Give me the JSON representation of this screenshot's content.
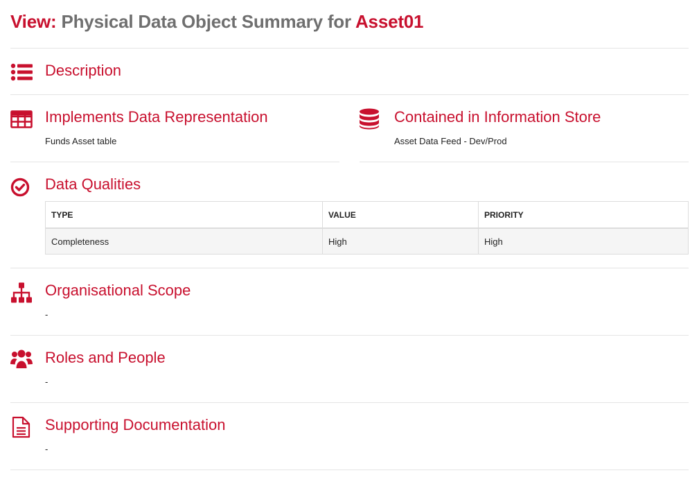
{
  "header": {
    "prefix": "View:",
    "title": "Physical Data Object Summary for",
    "entity": "Asset01"
  },
  "colors": {
    "accent": "#c8102e",
    "muted": "#6f6f6f",
    "divider": "#e4e4e4"
  },
  "sections": {
    "description": {
      "title": "Description",
      "icon": "list-icon"
    },
    "implements": {
      "title": "Implements Data Representation",
      "value": "Funds Asset table",
      "icon": "table-icon"
    },
    "contained": {
      "title": "Contained in Information Store",
      "value": "Asset Data Feed - Dev/Prod",
      "icon": "database-icon"
    },
    "qualities": {
      "title": "Data Qualities",
      "icon": "check-circle-icon",
      "columns": [
        "TYPE",
        "VALUE",
        "PRIORITY"
      ],
      "rows": [
        [
          "Completeness",
          "High",
          "High"
        ]
      ]
    },
    "org_scope": {
      "title": "Organisational Scope",
      "value": "-",
      "icon": "sitemap-icon"
    },
    "roles": {
      "title": "Roles and People",
      "value": "-",
      "icon": "users-icon"
    },
    "docs": {
      "title": "Supporting Documentation",
      "value": "-",
      "icon": "document-icon"
    }
  }
}
